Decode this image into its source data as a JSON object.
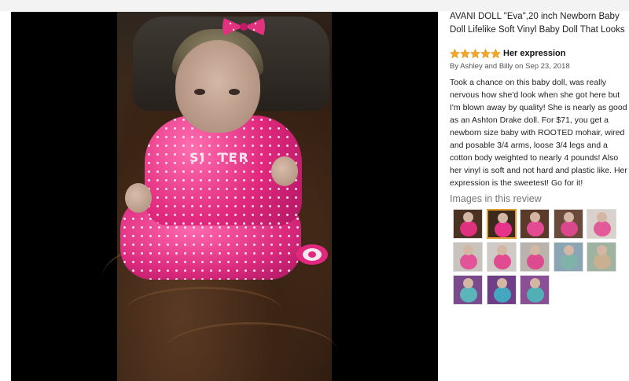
{
  "product": {
    "title_line1": "AVANI DOLL \"Eva\",20 inch Newborn Baby",
    "title_line2": "Doll Lifelike Soft Vinyl Baby Doll That Looks"
  },
  "review": {
    "rating": 5,
    "rating_max": 5,
    "headline": "Her expression",
    "byline": "By Ashley and Billy on Sep 23, 2018",
    "body": "Took a chance on this baby doll, was really nervous how she'd look when she got here but I'm blown away by quality! She is nearly as good as an Ashton Drake doll. For $71, you get a newborn size baby with ROOTED mohair, wired and posable 3/4 arms, loose 3/4 legs and a cotton body weighted to nearly 4 pounds! Also her vinyl is soft and not hard and plastic like. Her expression is the sweetest! Go for it!"
  },
  "gallery": {
    "heading": "Images in this review",
    "selected_index": 1,
    "thumbnails": [
      {
        "name": "thumb-1",
        "bg": "#4a3322",
        "fg": "#e0317f"
      },
      {
        "name": "thumb-2",
        "bg": "#3b2a1c",
        "fg": "#e8338a"
      },
      {
        "name": "thumb-3",
        "bg": "#5a3b2a",
        "fg": "#e44b92"
      },
      {
        "name": "thumb-4",
        "bg": "#6a4a3a",
        "fg": "#d9478c"
      },
      {
        "name": "thumb-5",
        "bg": "#d9d2cc",
        "fg": "#e25a98"
      },
      {
        "name": "thumb-6",
        "bg": "#c9c3be",
        "fg": "#e3539a"
      },
      {
        "name": "thumb-7",
        "bg": "#d0cac6",
        "fg": "#e14c90"
      },
      {
        "name": "thumb-8",
        "bg": "#b9b3ae",
        "fg": "#dd4a8e"
      },
      {
        "name": "thumb-9",
        "bg": "#8aa6b5",
        "fg": "#7fb3a9"
      },
      {
        "name": "thumb-10",
        "bg": "#9fb4a0",
        "fg": "#c9b090"
      },
      {
        "name": "thumb-11",
        "bg": "#7a4b8c",
        "fg": "#5ab6b8"
      },
      {
        "name": "thumb-12",
        "bg": "#6e3f86",
        "fg": "#44a7c1"
      },
      {
        "name": "thumb-13",
        "bg": "#8a4f95",
        "fg": "#51b0b5"
      }
    ]
  },
  "colors": {
    "star": "#f5a623",
    "star_stroke": "#d98a0a",
    "selected_thumb_border": "#e39b2f"
  },
  "icons": {
    "star": "star-icon",
    "bow": "bow-icon",
    "pacifier": "pacifier-icon"
  }
}
